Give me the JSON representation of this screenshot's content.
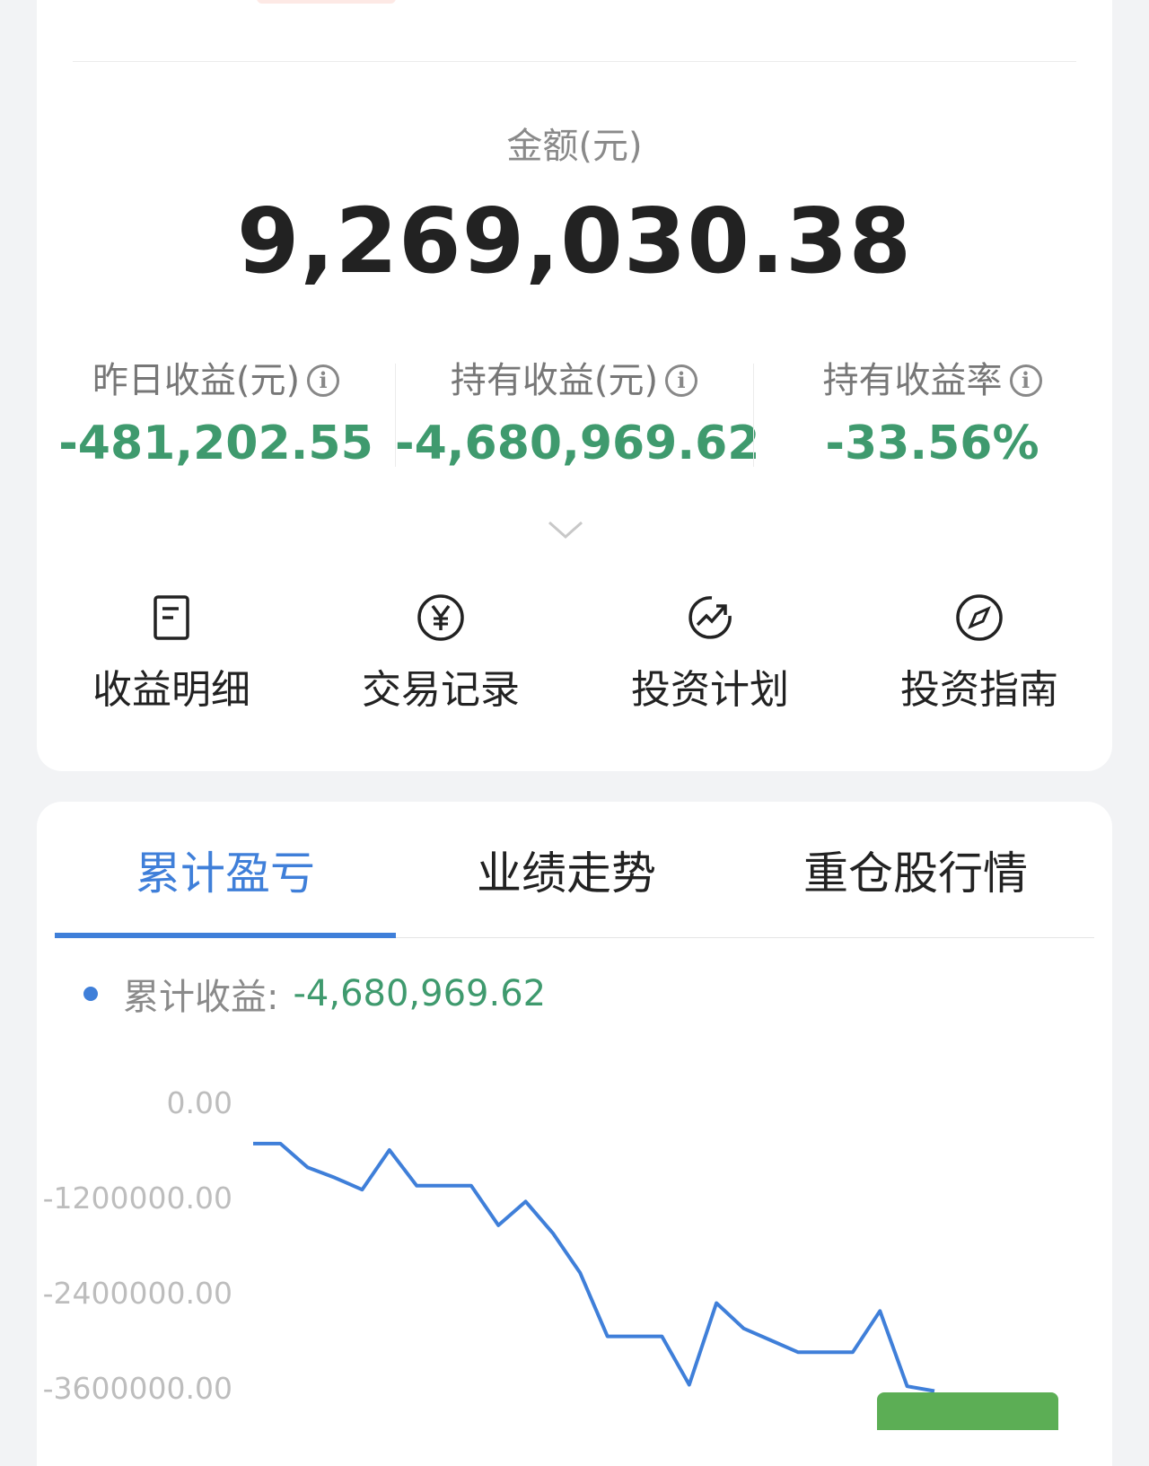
{
  "summary": {
    "amount_label": "金额(元)",
    "amount_value": "9,269,030.38",
    "stats": [
      {
        "label": "昨日收益(元)",
        "value": "-481,202.55"
      },
      {
        "label": "持有收益(元)",
        "value": "-4,680,969.62"
      },
      {
        "label": "持有收益率",
        "value": "-33.56%"
      }
    ],
    "info_glyph": "i"
  },
  "actions": [
    {
      "label": "收益明细",
      "icon": "document-icon"
    },
    {
      "label": "交易记录",
      "icon": "yuan-circle-icon"
    },
    {
      "label": "投资计划",
      "icon": "trend-up-icon"
    },
    {
      "label": "投资指南",
      "icon": "compass-icon"
    }
  ],
  "tabs": [
    {
      "label": "累计盈亏",
      "active": true
    },
    {
      "label": "业绩走势",
      "active": false
    },
    {
      "label": "重仓股行情",
      "active": false
    }
  ],
  "legend": {
    "label": "累计收益:",
    "value": "-4,680,969.62"
  },
  "colors": {
    "accent": "#3f7fd9",
    "loss": "#3f9a6e",
    "tag": "#fde9e5"
  },
  "chart_data": {
    "type": "line",
    "y_tick_labels": [
      "0.00",
      "-1200000.00",
      "-2400000.00",
      "-3600000.00"
    ],
    "y_ticks": [
      0,
      -1200000,
      -2400000,
      -3600000
    ],
    "ylim": [
      -3600000,
      0
    ],
    "series": [
      {
        "values": [
          -520000,
          -520000,
          -820000,
          -950000,
          -1100000,
          -600000,
          -1050000,
          -1050000,
          -1050000,
          -1550000,
          -1250000,
          -1650000,
          -2150000,
          -2950000,
          -2950000,
          -2950000,
          -3560000,
          -2530000,
          -2850000,
          -3000000,
          -3150000,
          -3150000,
          -3150000,
          -2630000,
          -3580000,
          -3640000
        ]
      }
    ]
  }
}
